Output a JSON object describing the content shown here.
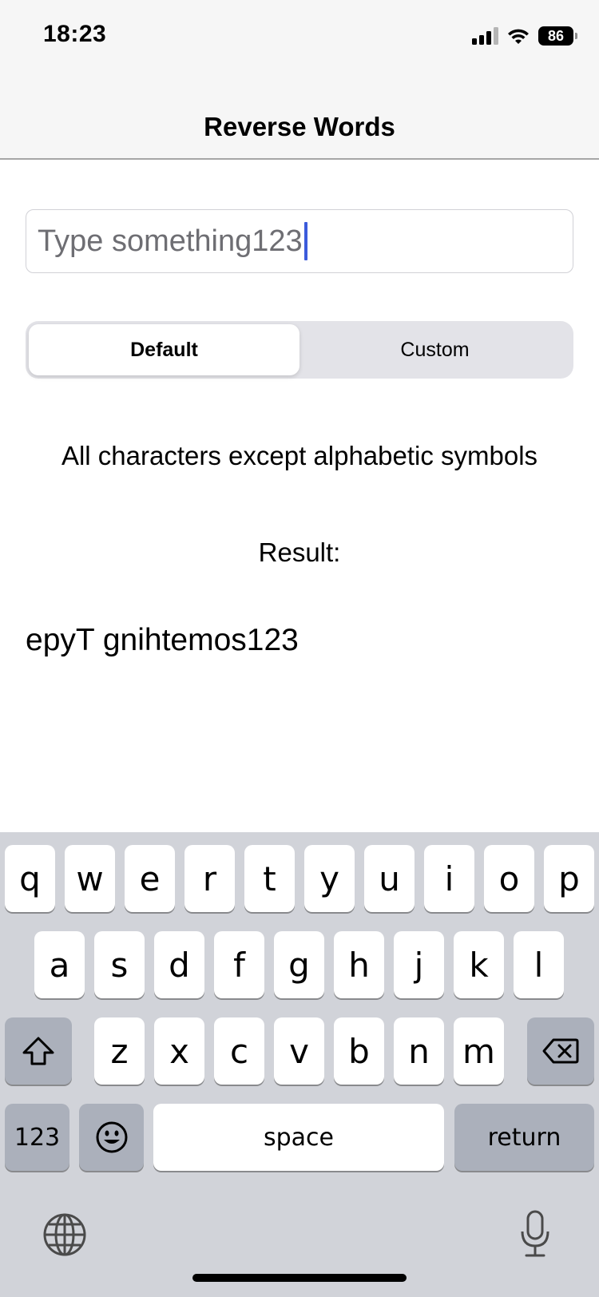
{
  "status_bar": {
    "time": "18:23",
    "battery_level": "86",
    "icons": [
      "cellular-signal-icon",
      "wifi-icon",
      "battery-icon"
    ]
  },
  "nav": {
    "title": "Reverse Words"
  },
  "text_field": {
    "value": "Type something123"
  },
  "segmented_control": {
    "segments": [
      "Default",
      "Custom"
    ],
    "selected": "Default"
  },
  "description": "All characters except alphabetic symbols",
  "result": {
    "label": "Result:",
    "value": "epyT gnihtemos123"
  },
  "keyboard": {
    "row1": [
      "q",
      "w",
      "e",
      "r",
      "t",
      "y",
      "u",
      "i",
      "o",
      "p"
    ],
    "row2": [
      "a",
      "s",
      "d",
      "f",
      "g",
      "h",
      "j",
      "k",
      "l"
    ],
    "row3": [
      "z",
      "x",
      "c",
      "v",
      "b",
      "n",
      "m"
    ],
    "numbers_label": "123",
    "space_label": "space",
    "return_label": "return",
    "icons": [
      "shift-icon",
      "delete-icon",
      "emoji-icon",
      "globe-icon",
      "microphone-icon"
    ]
  },
  "colors": {
    "caret": "#3b5bdb",
    "keyboard_bg": "#d1d3d9",
    "gray_key": "#abb0bb",
    "nav_bg": "#f6f6f6"
  }
}
